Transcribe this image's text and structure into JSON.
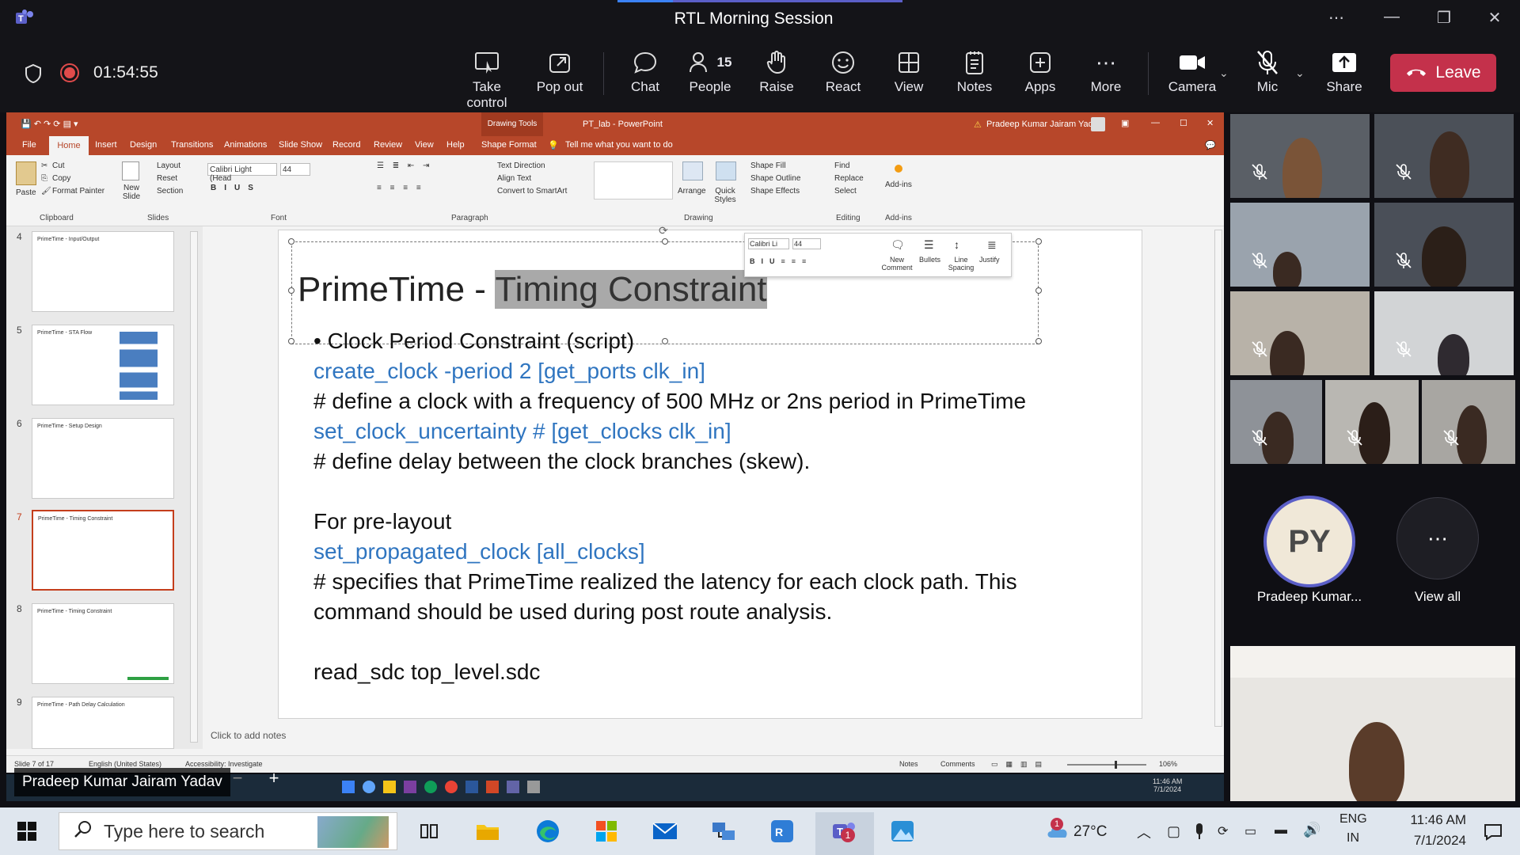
{
  "meeting": {
    "title": "RTL Morning Session",
    "timer": "01:54:55",
    "people_count": "15"
  },
  "toolbar": {
    "take_control": "Take control",
    "pop_out": "Pop out",
    "chat": "Chat",
    "people": "People",
    "raise": "Raise",
    "react": "React",
    "view": "View",
    "notes": "Notes",
    "apps": "Apps",
    "more": "More",
    "camera": "Camera",
    "mic": "Mic",
    "share": "Share",
    "leave": "Leave"
  },
  "ppt": {
    "window_title": "PT_lab - PowerPoint",
    "drawing_tools": "Drawing Tools",
    "user": "Pradeep Kumar Jairam Yadav",
    "tabs": [
      "File",
      "Home",
      "Insert",
      "Design",
      "Transitions",
      "Animations",
      "Slide Show",
      "Record",
      "Review",
      "View",
      "Help",
      "Shape Format"
    ],
    "tell_me": "Tell me what you want to do",
    "ribbon": {
      "paste": "Paste",
      "cut": "Cut",
      "copy": "Copy",
      "format_painter": "Format Painter",
      "clipboard": "Clipboard",
      "new_slide": "New Slide",
      "layout": "Layout",
      "reset": "Reset",
      "section": "Section",
      "slides": "Slides",
      "font_name": "Calibri Light (Head",
      "font_size": "44",
      "font": "Font",
      "paragraph": "Paragraph",
      "text_direction": "Text Direction",
      "align_text": "Align Text",
      "convert_smartart": "Convert to SmartArt",
      "drawing": "Drawing",
      "arrange": "Arrange",
      "quick_styles": "Quick Styles",
      "shape_fill": "Shape Fill",
      "shape_outline": "Shape Outline",
      "shape_effects": "Shape Effects",
      "find": "Find",
      "replace": "Replace",
      "select": "Select",
      "editing": "Editing",
      "addins": "Add-ins",
      "addins_group": "Add-ins"
    },
    "thumbnails": [
      {
        "num": "4",
        "title": "PrimeTime - Input/Output"
      },
      {
        "num": "5",
        "title": "PrimeTime - STA Flow"
      },
      {
        "num": "6",
        "title": "PrimeTime - Setup Design"
      },
      {
        "num": "7",
        "title": "PrimeTime - Timing Constraint"
      },
      {
        "num": "8",
        "title": "PrimeTime - Timing Constraint"
      },
      {
        "num": "9",
        "title": "PrimeTime - Path Delay Calculation"
      }
    ],
    "slide": {
      "title_plain": "PrimeTime - ",
      "title_selected": "Timing Constraint",
      "bullet": "• Clock Period Constraint (script)",
      "line1": "create_clock -period 2 [get_ports clk_in]",
      "line2": "# define a clock with a frequency of 500 MHz or 2ns period in PrimeTime",
      "line3": "set_clock_uncertainty # [get_clocks clk_in]",
      "line4": "# define delay between the clock branches (skew).",
      "line5": "For pre-layout",
      "line6": "set_propagated_clock [all_clocks]",
      "line7": "# specifies that PrimeTime realized the latency for each clock path. This",
      "line8": "command should be used during post route analysis.",
      "line9": "read_sdc top_level.sdc"
    },
    "minitb": {
      "font": "Calibri Li",
      "size": "44",
      "new_comment": "New Comment",
      "bullets": "Bullets",
      "line_spacing": "Line Spacing",
      "justify": "Justify"
    },
    "notes_placeholder": "Click to add notes",
    "status": {
      "slide": "Slide 7 of 17",
      "lang": "English (United States)",
      "access": "Accessibility: Investigate",
      "notes": "Notes",
      "comments": "Comments",
      "zoom": "106%"
    },
    "inner_clock": {
      "time": "11:46 AM",
      "date": "7/1/2024"
    }
  },
  "participants": {
    "presenter_initials": "PY",
    "presenter_name": "Pradeep Kumar...",
    "view_all": "View all",
    "presenter_fullname": "Pradeep Kumar Jairam Yadav"
  },
  "taskbar": {
    "search_placeholder": "Type here to search",
    "temp": "27°C",
    "lang1": "ENG",
    "lang2": "IN",
    "time": "11:46 AM",
    "date": "7/1/2024",
    "weather_badge": "1",
    "teams_badge": "1"
  }
}
